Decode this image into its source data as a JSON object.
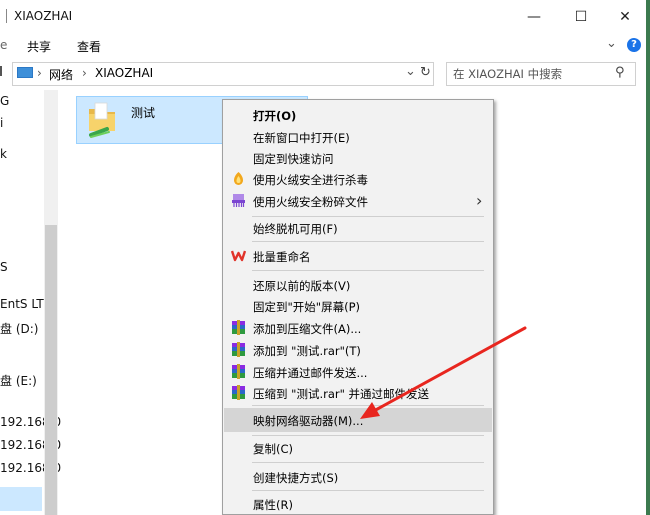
{
  "window": {
    "title": "XIAOZHAI",
    "minimize_glyph": "—",
    "maximize_glyph": "☐",
    "close_glyph": "✕",
    "help_glyph": "?",
    "collapse_glyph": "⌄"
  },
  "ribbon": {
    "tabs": [
      {
        "label": "共享"
      },
      {
        "label": "查看"
      }
    ]
  },
  "address": {
    "crumbs": [
      "网络",
      "XIAOZHAI"
    ],
    "separator": "›",
    "dropdown_glyph": "⌄",
    "refresh_glyph": "↻",
    "search_placeholder": "在 XIAOZHAI 中搜索",
    "search_glyph": "⚲"
  },
  "nav": {
    "items": [
      {
        "label": "G"
      },
      {
        "label": "i"
      },
      {
        "label": "k"
      },
      {
        "label": "S"
      },
      {
        "label": "EntS LT"
      },
      {
        "label": "盘 (D:)"
      },
      {
        "label": "盘 (E:)"
      },
      {
        "label": "192.168.0"
      },
      {
        "label": "192.168.0"
      },
      {
        "label": "192.168.0"
      }
    ]
  },
  "folder": {
    "name": "测试"
  },
  "context_menu": {
    "items": [
      {
        "label": "打开(O)",
        "bold": true
      },
      {
        "label": "在新窗口中打开(E)"
      },
      {
        "label": "固定到快速访问"
      },
      {
        "label": "使用火绒安全进行杀毒",
        "icon": "huorong-antivirus-icon"
      },
      {
        "label": "使用火绒安全粉碎文件",
        "icon": "huorong-shredder-icon",
        "submenu": true
      },
      {
        "label": "始终脱机可用(F)"
      },
      {
        "label": "批量重命名",
        "icon": "wps-icon"
      },
      {
        "label": "还原以前的版本(V)"
      },
      {
        "label": "固定到\"开始\"屏幕(P)"
      },
      {
        "label": "添加到压缩文件(A)...",
        "icon": "winrar-icon"
      },
      {
        "label": "添加到 \"测试.rar\"(T)",
        "icon": "winrar-icon"
      },
      {
        "label": "压缩并通过邮件发送...",
        "icon": "winrar-icon"
      },
      {
        "label": "压缩到 \"测试.rar\" 并通过邮件发送",
        "icon": "winrar-icon"
      },
      {
        "label": "映射网络驱动器(M)...",
        "highlighted": true
      },
      {
        "label": "复制(C)"
      },
      {
        "label": "创建快捷方式(S)"
      },
      {
        "label": "属性(R)"
      }
    ],
    "submenu_glyph": "›"
  },
  "colors": {
    "selection": "#cce8ff",
    "menu_bg": "#f2f2f2",
    "menu_highlight": "#d5d5d5",
    "arrow": "#e8261f",
    "accent_blue": "#1a73e8"
  }
}
